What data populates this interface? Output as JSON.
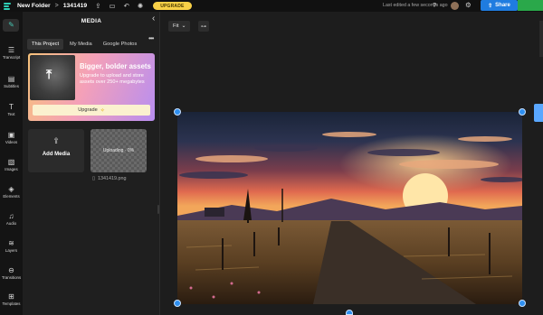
{
  "topbar": {
    "folder": "New Folder",
    "separator": ">",
    "project": "1341419",
    "upgrade_label": "UPGRADE",
    "last_edited": "Last edited a few seconds ago",
    "share_label": "Share"
  },
  "rail": {
    "items": [
      {
        "label": "",
        "icon": "magic-icon"
      },
      {
        "label": "Transcript",
        "icon": "transcript-icon"
      },
      {
        "label": "Subtitles",
        "icon": "subtitles-icon"
      },
      {
        "label": "Text",
        "icon": "text-icon"
      },
      {
        "label": "Videos",
        "icon": "film-icon"
      },
      {
        "label": "Images",
        "icon": "image-icon"
      },
      {
        "label": "Elements",
        "icon": "shapes-icon"
      },
      {
        "label": "Audio",
        "icon": "music-icon"
      },
      {
        "label": "Layers",
        "icon": "layers-icon"
      },
      {
        "label": "Transitions",
        "icon": "transition-icon"
      },
      {
        "label": "Templates",
        "icon": "grid-icon"
      }
    ]
  },
  "panel": {
    "title": "MEDIA",
    "tabs": [
      "This Project",
      "My Media",
      "Google Photos"
    ],
    "promo": {
      "title": "Bigger, bolder assets",
      "text": "Upgrade to upload and store assets over 250+ megabytes",
      "button": "Upgrade"
    },
    "add_media": "Add Media",
    "uploading": "Uploading · 0%",
    "file_name": "1341419.png"
  },
  "canvas": {
    "fit_label": "Fit",
    "accent": "#2e8ff0"
  }
}
